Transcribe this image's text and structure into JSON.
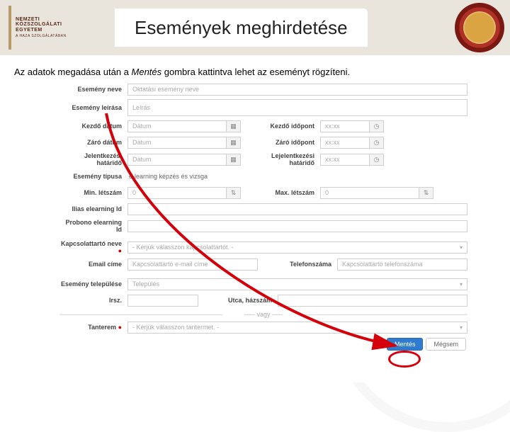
{
  "header": {
    "logo_line1": "NEMZETI",
    "logo_line2": "KÖZSZOLGÁLATI",
    "logo_line3": "EGYETEM",
    "logo_line4": "A HAZA SZOLGÁLATÁBAN",
    "title": "Események meghirdetése"
  },
  "instruction": {
    "prefix": "Az adatok megadása után a ",
    "emph": "Mentés",
    "suffix": " gombra kattintva lehet az eseményt rögzíteni."
  },
  "labels": {
    "event_name": "Esemény neve",
    "event_desc": "Esemény leírása",
    "start_date": "Kezdő dátum",
    "start_time": "Kezdő időpont",
    "end_date": "Záró dátum",
    "end_time": "Záró időpont",
    "reg_deadline_date": "Jelentkezési határidő",
    "reg_deadline_time": "Lejelentkezési határidő",
    "event_type": "Esemény típusa",
    "min_headcount": "Min. létszám",
    "max_headcount": "Max. létszám",
    "ilias_id": "Ilias elearning Id",
    "probono_id": "Probono elearning Id",
    "contact_name": "Kapcsolattartó neve",
    "contact_email": "Email címe",
    "contact_phone": "Telefonszáma",
    "event_city": "Esemény települése",
    "zip": "Irsz.",
    "street": "Utca, házszám",
    "room": "Tanterem"
  },
  "placeholders": {
    "event_name": "Oktatási esemény neve",
    "event_desc": "Leírás",
    "date": "Dátum",
    "time": "xx:xx",
    "contact_select": "- Kérjük válasszon kapcsolattartót. -",
    "contact_email": "Kapcsolattartó e-mail címe",
    "contact_phone": "Kapcsolattartó telefonszáma",
    "city": "Település",
    "room_select": "- Kérjük válasszon tantermet. -"
  },
  "values": {
    "event_type": "e-learning képzés és vizsga",
    "min_headcount": "0",
    "max_headcount": "0"
  },
  "divider": "----- vagy -----",
  "buttons": {
    "save": "Mentés",
    "cancel": "Mégsem"
  },
  "icons": {
    "calendar": "▦",
    "clock": "◷",
    "caret": "▾",
    "stepper": "⇅"
  }
}
